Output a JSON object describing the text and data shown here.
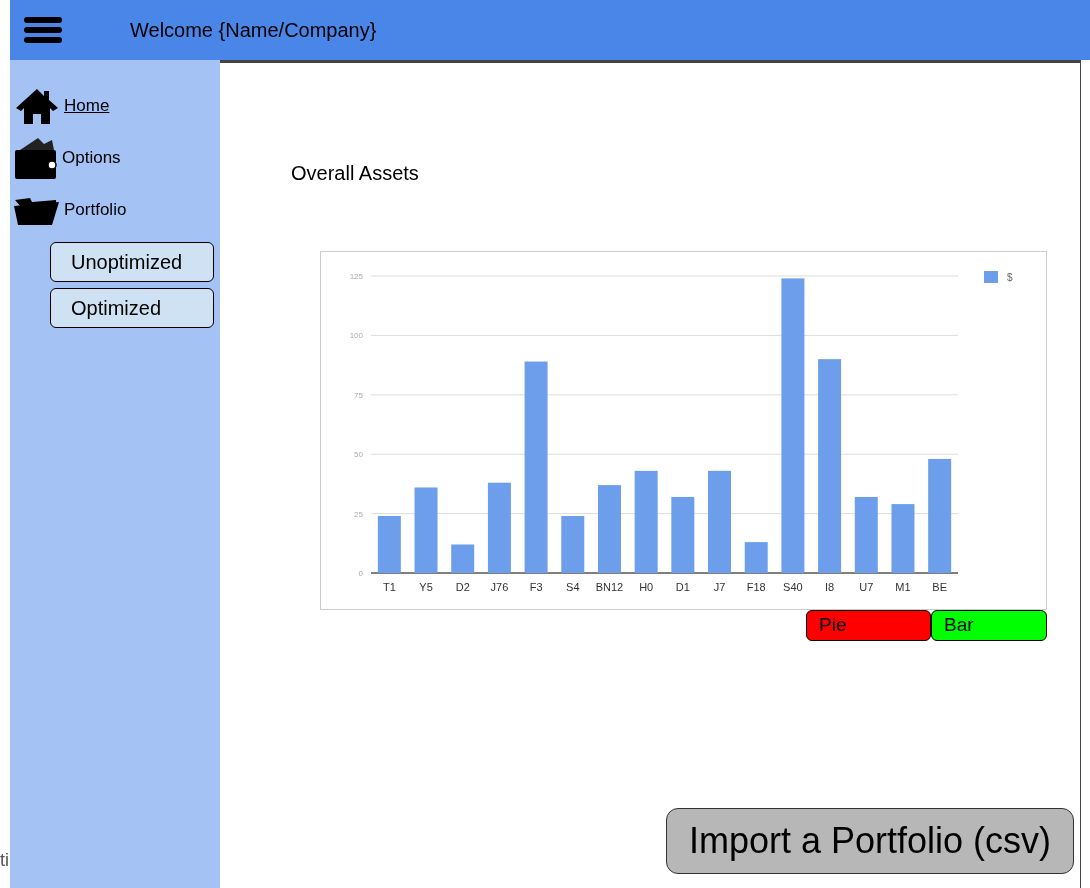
{
  "header": {
    "title": "Welcome {Name/Company}"
  },
  "sidebar": {
    "items": [
      {
        "label": "Home",
        "kind": "home",
        "selected": true
      },
      {
        "label": "Options",
        "kind": "wallet",
        "selected": false
      },
      {
        "label": "Portfolio",
        "kind": "folder",
        "selected": false
      }
    ],
    "sub_items": [
      {
        "label": "Unoptimized"
      },
      {
        "label": "Optimized"
      }
    ]
  },
  "edge_text": "ti",
  "main": {
    "title": "Overall Assets",
    "chart_data": {
      "type": "bar",
      "categories": [
        "T1",
        "Y5",
        "D2",
        "J76",
        "F3",
        "S4",
        "BN12",
        "H0",
        "D1",
        "J7",
        "F18",
        "S40",
        "I8",
        "U7",
        "M1",
        "BE"
      ],
      "series": [
        {
          "name": "$",
          "color": "#6d9eeb",
          "values": [
            24,
            36,
            12,
            38,
            89,
            24,
            37,
            43,
            32,
            43,
            13,
            124,
            90,
            32,
            29,
            48
          ]
        }
      ],
      "ylim": [
        0,
        125
      ],
      "grid": true,
      "yticks": [
        0,
        25,
        50,
        75,
        100,
        125
      ]
    },
    "chart_buttons": [
      {
        "label": "Pie",
        "color": "#ff0000"
      },
      {
        "label": "Bar",
        "color": "#00ff00"
      }
    ],
    "import_button": "Import a Portfolio (csv)"
  }
}
